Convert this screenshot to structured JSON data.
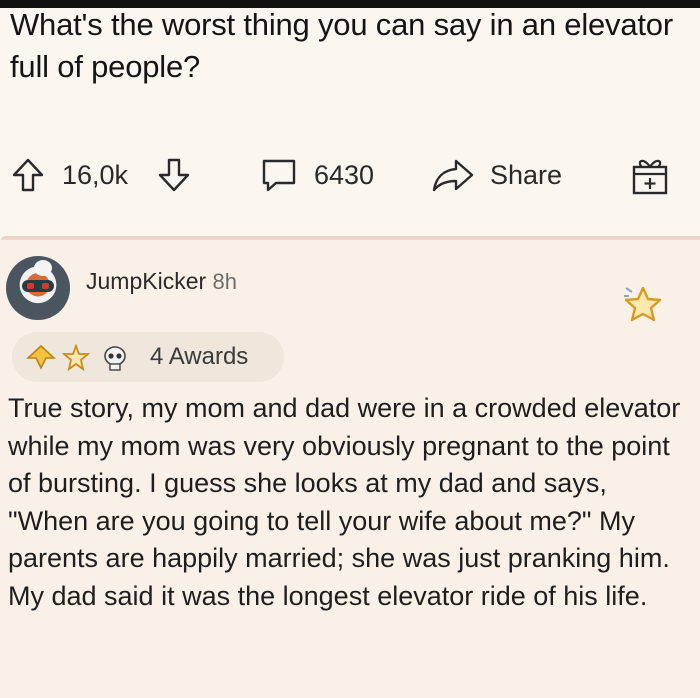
{
  "post": {
    "title": "What's the worst thing you can say in an elevator full of people?",
    "upvotes": "16,0k",
    "comments": "6430",
    "share_label": "Share"
  },
  "comment": {
    "username": "JumpKicker",
    "age": "8h",
    "awards_label": "4 Awards",
    "body": "True story, my mom and dad were in a crowded elevator while my mom was very obviously pregnant to the point of bursting. I guess she looks at my dad and says, \"When are you going to tell your wife about me?\" My parents are happily married; she was just pranking him. My dad said it was the longest elevator ride of his life."
  },
  "icons": {
    "upvote": "arrow-up-icon",
    "downvote": "arrow-down-icon",
    "comment": "comment-bubble-icon",
    "share": "share-arrow-icon",
    "award": "gift-award-icon",
    "star": "star-icon",
    "skull": "skull-icon"
  },
  "colors": {
    "background": "#fbf6ef",
    "comment_background": "#f9f1e8",
    "award_gold": "#f0b43a"
  }
}
